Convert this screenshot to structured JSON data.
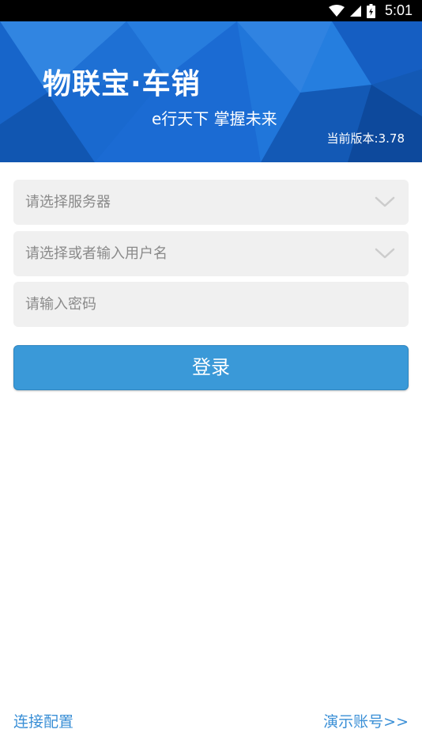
{
  "status_bar": {
    "time": "5:01",
    "icons": [
      "wifi-icon",
      "cellular-signal-icon",
      "battery-icon"
    ]
  },
  "banner": {
    "title": "物联宝·车销",
    "slogan": "e行天下 掌握未来",
    "version": "当前版本:3.78"
  },
  "form": {
    "server_select": {
      "placeholder": "请选择服务器",
      "icon": "chevron-down-icon"
    },
    "username_select": {
      "placeholder": "请选择或者输入用户名",
      "icon": "chevron-down-icon"
    },
    "password": {
      "placeholder": "请输入密码",
      "value": ""
    },
    "login_label": "登录"
  },
  "footer": {
    "connection_config": "连接配置",
    "demo_account": "演示账号>>"
  },
  "colors": {
    "banner_blue": "#1d72d8",
    "button_blue": "#3a99d8",
    "link_blue": "#3a8fd6",
    "field_bg": "#f0f0f0"
  }
}
